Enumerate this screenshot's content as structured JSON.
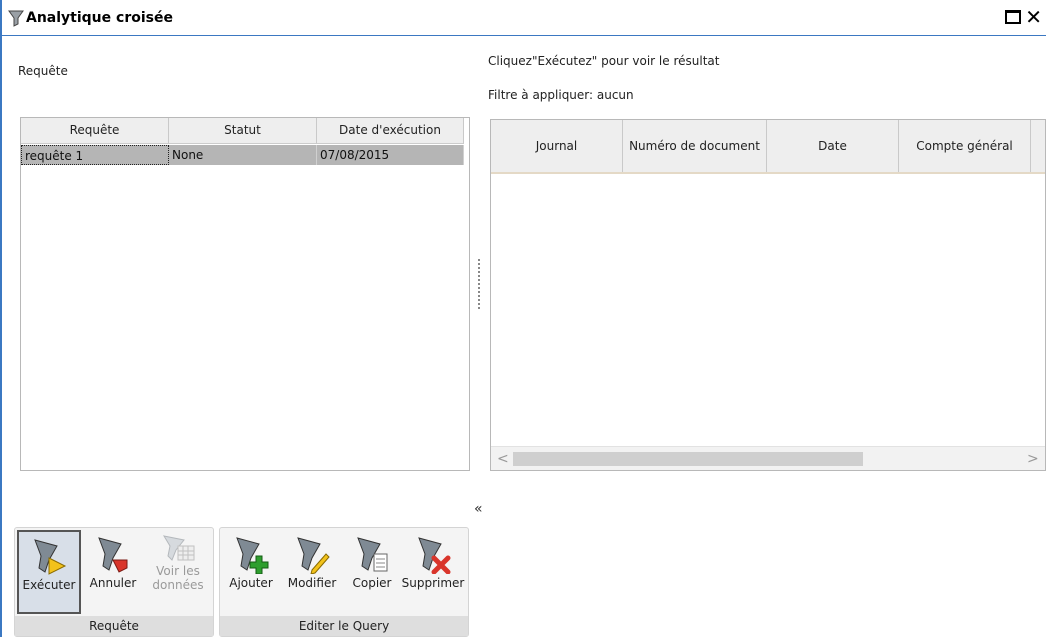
{
  "window": {
    "title": "Analytique croisée",
    "icon": "filter-icon",
    "controls": [
      "maximize-icon",
      "close-icon"
    ],
    "close_glyph": "✕"
  },
  "left_panel": {
    "label": "Requête",
    "columns": [
      "Requête",
      "Statut",
      "Date d'exécution"
    ],
    "rows": [
      {
        "requete": "requête 1",
        "statut": "None",
        "date": "07/08/2015"
      }
    ]
  },
  "right_panel": {
    "hint": "Cliquez\"Exécutez\" pour voir le résultat",
    "filter": "Filtre à appliquer: aucun",
    "columns": [
      "Journal",
      "Numéro de document",
      "Date",
      "Compte général"
    ]
  },
  "splitter": {
    "collapse_glyph": "«"
  },
  "scrollbar": {
    "left_arrow": "<",
    "right_arrow": ">"
  },
  "toolbar": {
    "groups": [
      {
        "label": "Requête",
        "buttons": [
          {
            "label": "Exécuter",
            "icon": "run-query-icon",
            "state": "active"
          },
          {
            "label": "Annuler",
            "icon": "cancel-query-icon",
            "state": "normal"
          },
          {
            "label": "Voir les données",
            "icon": "view-data-icon",
            "state": "disabled"
          }
        ]
      },
      {
        "label": "Editer le Query",
        "buttons": [
          {
            "label": "Ajouter",
            "icon": "add-query-icon",
            "state": "normal"
          },
          {
            "label": "Modifier",
            "icon": "edit-query-icon",
            "state": "normal"
          },
          {
            "label": "Copier",
            "icon": "copy-query-icon",
            "state": "normal"
          },
          {
            "label": "Supprimer",
            "icon": "delete-query-icon",
            "state": "normal"
          }
        ]
      }
    ]
  },
  "colors": {
    "window_border": "#3b78c2",
    "selected_row": "#b5b5b5",
    "header_bg": "#eeeeee",
    "add_green": "#2e9e2e",
    "delete_red": "#d9352b"
  }
}
